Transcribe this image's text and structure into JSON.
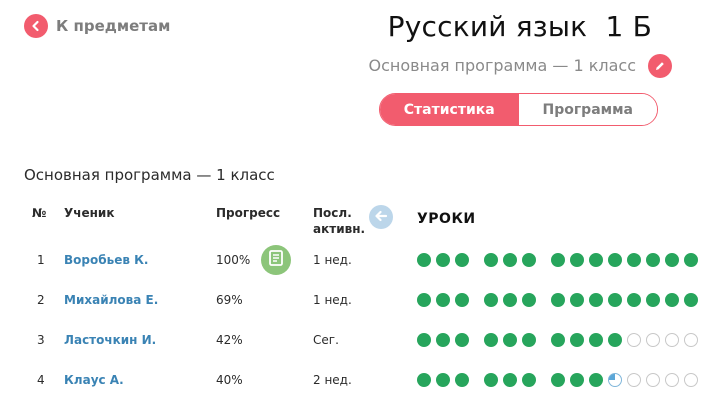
{
  "nav": {
    "back_label": "К предметам"
  },
  "header": {
    "title": "Русский язык  1 Б",
    "subtitle": "Основная программа — 1 класс"
  },
  "tabs": [
    {
      "label": "Статистика",
      "active": true
    },
    {
      "label": "Программа",
      "active": false
    }
  ],
  "section_title": "Основная программа — 1 класс",
  "table": {
    "headers": {
      "num": "№",
      "student": "Ученик",
      "progress": "Прогресс",
      "last_activity": "Посл. активн.",
      "lessons": "УРОКИ"
    },
    "rows": [
      {
        "num": "1",
        "name": "Воробьев К.",
        "progress": "100%",
        "last": "1 нед.",
        "has_report": true,
        "lessons": [
          "done",
          "done",
          "done",
          "done",
          "done",
          "done",
          "done",
          "done",
          "done",
          "done",
          "done",
          "done",
          "done",
          "done"
        ]
      },
      {
        "num": "2",
        "name": "Михайлова Е.",
        "progress": "69%",
        "last": "1 нед.",
        "has_report": false,
        "lessons": [
          "done",
          "done",
          "done",
          "done",
          "done",
          "done",
          "done",
          "done",
          "done",
          "done",
          "done",
          "done",
          "done",
          "done"
        ]
      },
      {
        "num": "3",
        "name": "Ласточкин И.",
        "progress": "42%",
        "last": "Сег.",
        "has_report": false,
        "lessons": [
          "done",
          "done",
          "done",
          "done",
          "done",
          "done",
          "done",
          "done",
          "done",
          "done",
          "todo",
          "todo",
          "todo",
          "todo"
        ]
      },
      {
        "num": "4",
        "name": "Клаус А.",
        "progress": "40%",
        "last": "2 нед.",
        "has_report": false,
        "lessons": [
          "done",
          "done",
          "done",
          "done",
          "done",
          "done",
          "done",
          "done",
          "done",
          "partial",
          "todo",
          "todo",
          "todo",
          "todo"
        ]
      }
    ]
  },
  "colors": {
    "accent": "#f25c6e",
    "lesson_done": "#27a55c",
    "link": "#3a83b4",
    "report_button": "#8cc57a",
    "scroll_button": "#bcd6ea"
  },
  "icons": {
    "back": "arrow-left-icon",
    "edit": "pencil-icon",
    "report": "document-icon",
    "scroll": "arrow-left-icon"
  }
}
